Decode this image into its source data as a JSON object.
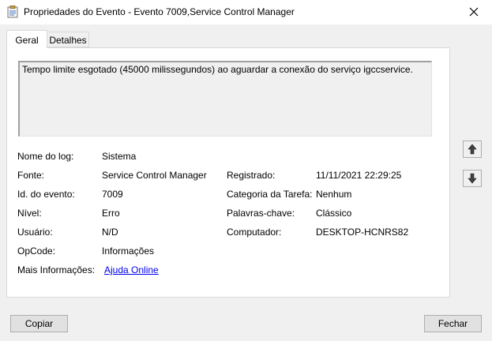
{
  "window": {
    "title": "Propriedades do Evento - Evento 7009,Service Control Manager"
  },
  "tabs": [
    {
      "label": "Geral",
      "active": true
    },
    {
      "label": "Detalhes",
      "active": false
    }
  ],
  "message": "Tempo limite esgotado (45000 milissegundos) ao aguardar a conexão do serviço igccservice.",
  "fields": {
    "log_name": {
      "label": "Nome do log:",
      "value": "Sistema"
    },
    "source": {
      "label": "Fonte:",
      "value": "Service Control Manager"
    },
    "event_id": {
      "label": "Id. do evento:",
      "value": "7009"
    },
    "level": {
      "label": "Nível:",
      "value": "Erro"
    },
    "user": {
      "label": "Usuário:",
      "value": "N/D"
    },
    "opcode": {
      "label": "OpCode:",
      "value": "Informações"
    },
    "more_info": {
      "label": "Mais Informações:",
      "value": "Ajuda Online"
    },
    "logged": {
      "label": "Registrado:",
      "value": "11/11/2021 22:29:25"
    },
    "task_category": {
      "label": "Categoria da Tarefa:",
      "value": "Nenhum"
    },
    "keywords": {
      "label": "Palavras-chave:",
      "value": "Clássico"
    },
    "computer": {
      "label": "Computador:",
      "value": "DESKTOP-HCNRS82"
    }
  },
  "buttons": {
    "copy": "Copiar",
    "close": "Fechar"
  },
  "icons": {
    "app": "event-viewer-icon",
    "close": "close-icon",
    "up": "arrow-up-icon",
    "down": "arrow-down-icon"
  },
  "colors": {
    "link": "#0000ee",
    "window_bg": "#f0f0f0",
    "panel_bg": "#ffffff"
  }
}
